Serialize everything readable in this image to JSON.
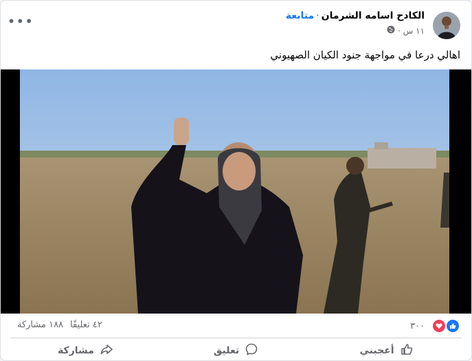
{
  "post": {
    "author": "الكادح اسامه الشرمان",
    "follow_label": "متابعة",
    "separator": "·",
    "time": "١١ س ·",
    "more_label": "•••",
    "caption": "اهالي درعا في مواجهة جنود الكيان الصهيوني"
  },
  "stats": {
    "reactions_count": "٣٠٠",
    "comments": "٤٢ تعليقًا",
    "shares": "١٨٨ مشاركة"
  },
  "actions": {
    "like": "أعجبني",
    "comment": "تعليق",
    "share": "مشاركة"
  },
  "icons": {
    "privacy": "globe-icon",
    "like": "thumbs-up-icon",
    "comment": "comment-icon",
    "share": "share-arrow-icon"
  },
  "colors": {
    "link": "#1877f2",
    "like": "#1877f2",
    "love": "#f33e58",
    "muted": "#65676b"
  }
}
